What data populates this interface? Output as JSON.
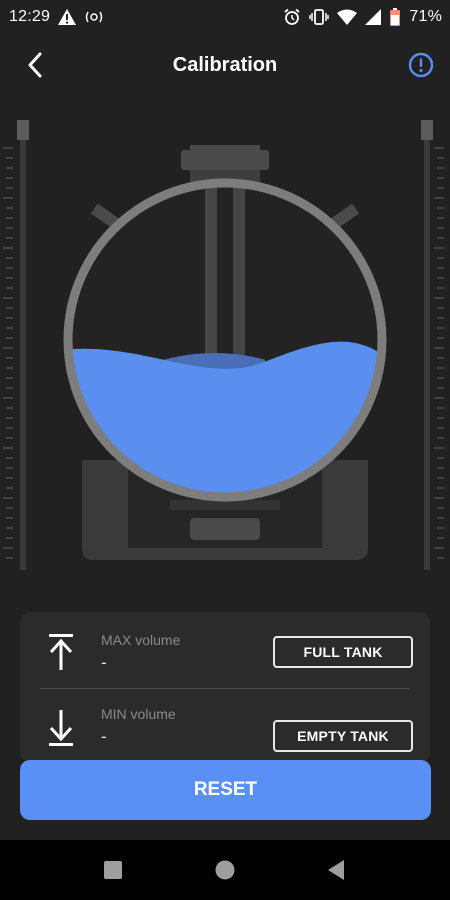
{
  "status_bar": {
    "time": "12:29",
    "battery": "71%",
    "left_icons": [
      "warning-icon",
      "nfc-icon"
    ],
    "right_icons": [
      "alarm-icon",
      "vibrate-icon",
      "wifi-icon",
      "signal-icon",
      "battery-icon"
    ]
  },
  "header": {
    "title": "Calibration",
    "back_icon": "chevron-left-icon",
    "info_icon": "info-icon"
  },
  "colors": {
    "background": "#212121",
    "card": "#2b2b2b",
    "accent": "#5a90f5",
    "water": "#5a8ff0",
    "tank_ring": "#7d7d7d",
    "machine": "#3a3a3a"
  },
  "illustration": {
    "fill_level": 0.45
  },
  "controls": {
    "max": {
      "label": "MAX volume",
      "value": "-",
      "button": "FULL TANK",
      "icon": "arrow-up-to-line-icon"
    },
    "min": {
      "label": "MIN volume",
      "value": "-",
      "button": "EMPTY TANK",
      "icon": "arrow-down-to-line-icon"
    }
  },
  "reset_button": "RESET",
  "nav": [
    "square-icon",
    "home-circle-icon",
    "back-triangle-icon"
  ]
}
